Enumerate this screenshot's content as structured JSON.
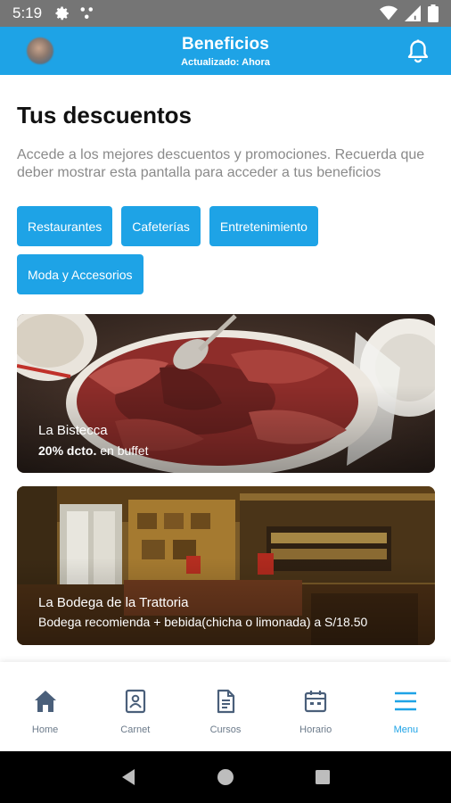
{
  "status_bar": {
    "time": "5:19",
    "icons": [
      "gear-icon",
      "dots-icon",
      "wifi-icon",
      "signal-icon",
      "battery-icon"
    ]
  },
  "header": {
    "title": "Beneficios",
    "subtitle": "Actualizado: Ahora",
    "background": "#1ea3e6"
  },
  "main": {
    "title": "Tus descuentos",
    "description": "Accede a los mejores descuentos y promociones. Recuerda que deber mostrar esta pantalla para acceder a tus beneficios",
    "categories": [
      {
        "label": "Restaurantes"
      },
      {
        "label": "Cafeterías"
      },
      {
        "label": "Entretenimiento"
      },
      {
        "label": "Moda y Accesorios"
      }
    ],
    "offers": [
      {
        "name": "La Bistecca",
        "offer_bold": "20% dcto.",
        "offer_rest": " en buffet"
      },
      {
        "name": "La Bodega de la Trattoria",
        "offer_bold": "",
        "offer_rest": "Bodega recomienda + bebida(chicha o limonada) a S/18.50"
      }
    ]
  },
  "bottom_nav": {
    "items": [
      {
        "label": "Home",
        "icon": "home-icon"
      },
      {
        "label": "Carnet",
        "icon": "id-card-icon"
      },
      {
        "label": "Cursos",
        "icon": "document-icon"
      },
      {
        "label": "Horario",
        "icon": "calendar-icon"
      },
      {
        "label": "Menu",
        "icon": "menu-icon",
        "active": true
      }
    ],
    "active_color": "#1ea3e6",
    "inactive_color": "#4a5f7a"
  }
}
